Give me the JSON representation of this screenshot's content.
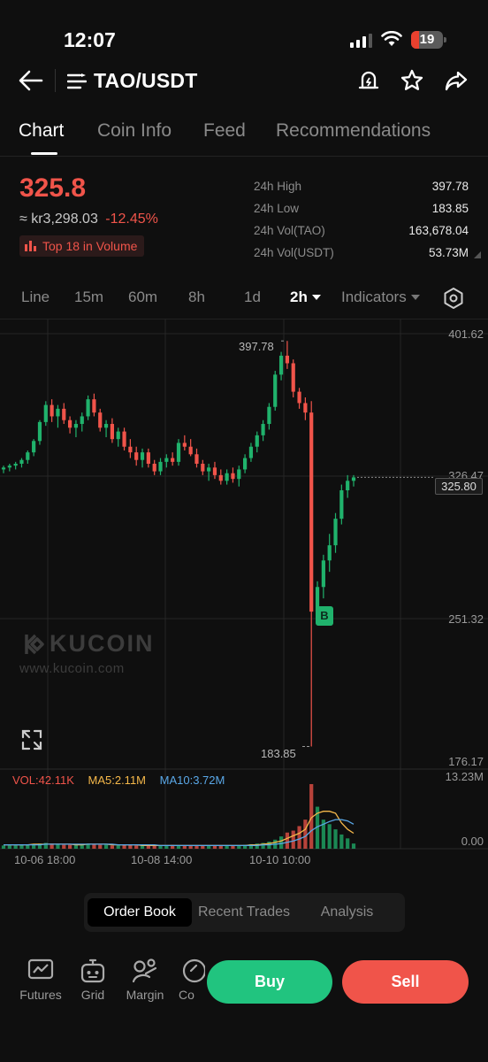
{
  "status": {
    "time": "12:07",
    "battery": "19"
  },
  "header": {
    "pair": "TAO/USDT"
  },
  "tabs": [
    "Chart",
    "Coin Info",
    "Feed",
    "Recommendations"
  ],
  "ticker": {
    "price": "325.8",
    "fiat": "≈ kr3,298.03",
    "change": "-12.45%",
    "rank_badge": "Top 18 in Volume"
  },
  "stats": [
    {
      "label": "24h High",
      "value": "397.78"
    },
    {
      "label": "24h Low",
      "value": "183.85"
    },
    {
      "label": "24h Vol(TAO)",
      "value": "163,678.04"
    },
    {
      "label": "24h Vol(USDT)",
      "value": "53.73M"
    }
  ],
  "timeframes": {
    "line": "Line",
    "m15": "15m",
    "m60": "60m",
    "h8": "8h",
    "d1": "1d",
    "selected": "2h",
    "indicators": "Indicators"
  },
  "chart": {
    "y_labels": [
      "401.62",
      "326.47",
      "251.32",
      "176.17"
    ],
    "current_price": "325.80",
    "high_label": "397.78",
    "low_label": "183.85",
    "trade_marker": "B",
    "vol_legend": {
      "vol": "VOL:42.11K",
      "ma5": "MA5:2.11M",
      "ma10": "MA10:3.72M"
    },
    "vol_labels": [
      "13.23M",
      "0.00"
    ],
    "x_labels": [
      "10-06 18:00",
      "10-08 14:00",
      "10-10 10:00"
    ],
    "watermark": {
      "brand": "KUCOIN",
      "url": "www.kucoin.com"
    },
    "colors": {
      "up": "#20b26c",
      "down": "#f0544a",
      "ma5": "#f5b84a",
      "ma10": "#5aa8e8"
    }
  },
  "chart_data": {
    "type": "candlestick",
    "y_range": [
      176.17,
      401.62
    ],
    "current": 325.8,
    "high": 397.78,
    "low": 183.85,
    "candles": [
      [
        330,
        332,
        328,
        331
      ],
      [
        331,
        333,
        329,
        332
      ],
      [
        332,
        334,
        330,
        333
      ],
      [
        333,
        336,
        331,
        335
      ],
      [
        335,
        340,
        333,
        339
      ],
      [
        339,
        346,
        337,
        345
      ],
      [
        345,
        356,
        343,
        355
      ],
      [
        355,
        366,
        353,
        364
      ],
      [
        364,
        367,
        355,
        358
      ],
      [
        358,
        364,
        352,
        362
      ],
      [
        362,
        365,
        354,
        356
      ],
      [
        356,
        358,
        349,
        352
      ],
      [
        352,
        356,
        347,
        354
      ],
      [
        354,
        360,
        350,
        358
      ],
      [
        358,
        369,
        356,
        367
      ],
      [
        367,
        370,
        358,
        360
      ],
      [
        360,
        362,
        350,
        352
      ],
      [
        352,
        356,
        347,
        354
      ],
      [
        354,
        357,
        344,
        346
      ],
      [
        346,
        352,
        342,
        350
      ],
      [
        350,
        352,
        340,
        342
      ],
      [
        342,
        346,
        336,
        339
      ],
      [
        339,
        342,
        332,
        335
      ],
      [
        335,
        341,
        331,
        339
      ],
      [
        339,
        341,
        331,
        333
      ],
      [
        333,
        335,
        327,
        329
      ],
      [
        329,
        336,
        327,
        334
      ],
      [
        334,
        338,
        331,
        336
      ],
      [
        336,
        339,
        332,
        334
      ],
      [
        334,
        346,
        332,
        344
      ],
      [
        344,
        348,
        340,
        342
      ],
      [
        342,
        346,
        337,
        338
      ],
      [
        338,
        341,
        331,
        333
      ],
      [
        333,
        335,
        327,
        329
      ],
      [
        329,
        333,
        324,
        331
      ],
      [
        331,
        334,
        325,
        327
      ],
      [
        327,
        330,
        322,
        324
      ],
      [
        324,
        330,
        322,
        328
      ],
      [
        328,
        331,
        323,
        325
      ],
      [
        325,
        332,
        321,
        330
      ],
      [
        330,
        338,
        328,
        336
      ],
      [
        336,
        344,
        334,
        342
      ],
      [
        342,
        350,
        339,
        348
      ],
      [
        348,
        356,
        345,
        354
      ],
      [
        354,
        365,
        351,
        363
      ],
      [
        363,
        382,
        361,
        380
      ],
      [
        380,
        392,
        377,
        390
      ],
      [
        390,
        397.78,
        383,
        386
      ],
      [
        386,
        388,
        368,
        371
      ],
      [
        371,
        373,
        362,
        365
      ],
      [
        365,
        368,
        356,
        360
      ],
      [
        360,
        366,
        183.85,
        255
      ],
      [
        255,
        271,
        248,
        268
      ],
      [
        268,
        285,
        262,
        282
      ],
      [
        282,
        296,
        276,
        290
      ],
      [
        290,
        307,
        286,
        304
      ],
      [
        304,
        322,
        301,
        319
      ],
      [
        319,
        327,
        315,
        324
      ],
      [
        324,
        327,
        321,
        325.8
      ]
    ],
    "volume": [
      0.05,
      0.05,
      0.05,
      0.06,
      0.06,
      0.07,
      0.08,
      0.09,
      0.08,
      0.07,
      0.06,
      0.06,
      0.06,
      0.07,
      0.08,
      0.07,
      0.06,
      0.06,
      0.05,
      0.05,
      0.06,
      0.06,
      0.05,
      0.05,
      0.05,
      0.05,
      0.05,
      0.05,
      0.06,
      0.05,
      0.05,
      0.05,
      0.05,
      0.05,
      0.05,
      0.05,
      0.05,
      0.05,
      0.05,
      0.05,
      0.06,
      0.07,
      0.08,
      0.09,
      0.11,
      0.14,
      0.19,
      0.25,
      0.28,
      0.35,
      0.45,
      1.0,
      0.65,
      0.45,
      0.38,
      0.3,
      0.22,
      0.16,
      0.08
    ],
    "ma5": [
      0.06,
      0.06,
      0.06,
      0.06,
      0.06,
      0.07,
      0.07,
      0.07,
      0.07,
      0.07,
      0.07,
      0.07,
      0.06,
      0.06,
      0.07,
      0.07,
      0.07,
      0.07,
      0.06,
      0.06,
      0.06,
      0.06,
      0.06,
      0.05,
      0.05,
      0.05,
      0.05,
      0.05,
      0.05,
      0.05,
      0.05,
      0.05,
      0.05,
      0.05,
      0.05,
      0.05,
      0.05,
      0.05,
      0.05,
      0.05,
      0.05,
      0.06,
      0.06,
      0.07,
      0.08,
      0.1,
      0.12,
      0.16,
      0.2,
      0.24,
      0.3,
      0.48,
      0.55,
      0.58,
      0.58,
      0.55,
      0.4,
      0.3,
      0.24
    ],
    "ma10": [
      0.06,
      0.06,
      0.06,
      0.06,
      0.06,
      0.06,
      0.06,
      0.07,
      0.07,
      0.07,
      0.07,
      0.07,
      0.07,
      0.07,
      0.07,
      0.07,
      0.07,
      0.07,
      0.07,
      0.06,
      0.06,
      0.06,
      0.06,
      0.06,
      0.06,
      0.06,
      0.05,
      0.05,
      0.05,
      0.05,
      0.05,
      0.05,
      0.05,
      0.05,
      0.05,
      0.05,
      0.05,
      0.05,
      0.05,
      0.05,
      0.05,
      0.05,
      0.05,
      0.06,
      0.06,
      0.07,
      0.08,
      0.1,
      0.12,
      0.15,
      0.19,
      0.28,
      0.34,
      0.38,
      0.42,
      0.45,
      0.45,
      0.43,
      0.38
    ]
  },
  "segment": [
    "Order Book",
    "Recent Trades",
    "Analysis"
  ],
  "bottom_nav": [
    "Futures",
    "Grid",
    "Margin",
    "Co"
  ],
  "actions": {
    "buy": "Buy",
    "sell": "Sell"
  }
}
